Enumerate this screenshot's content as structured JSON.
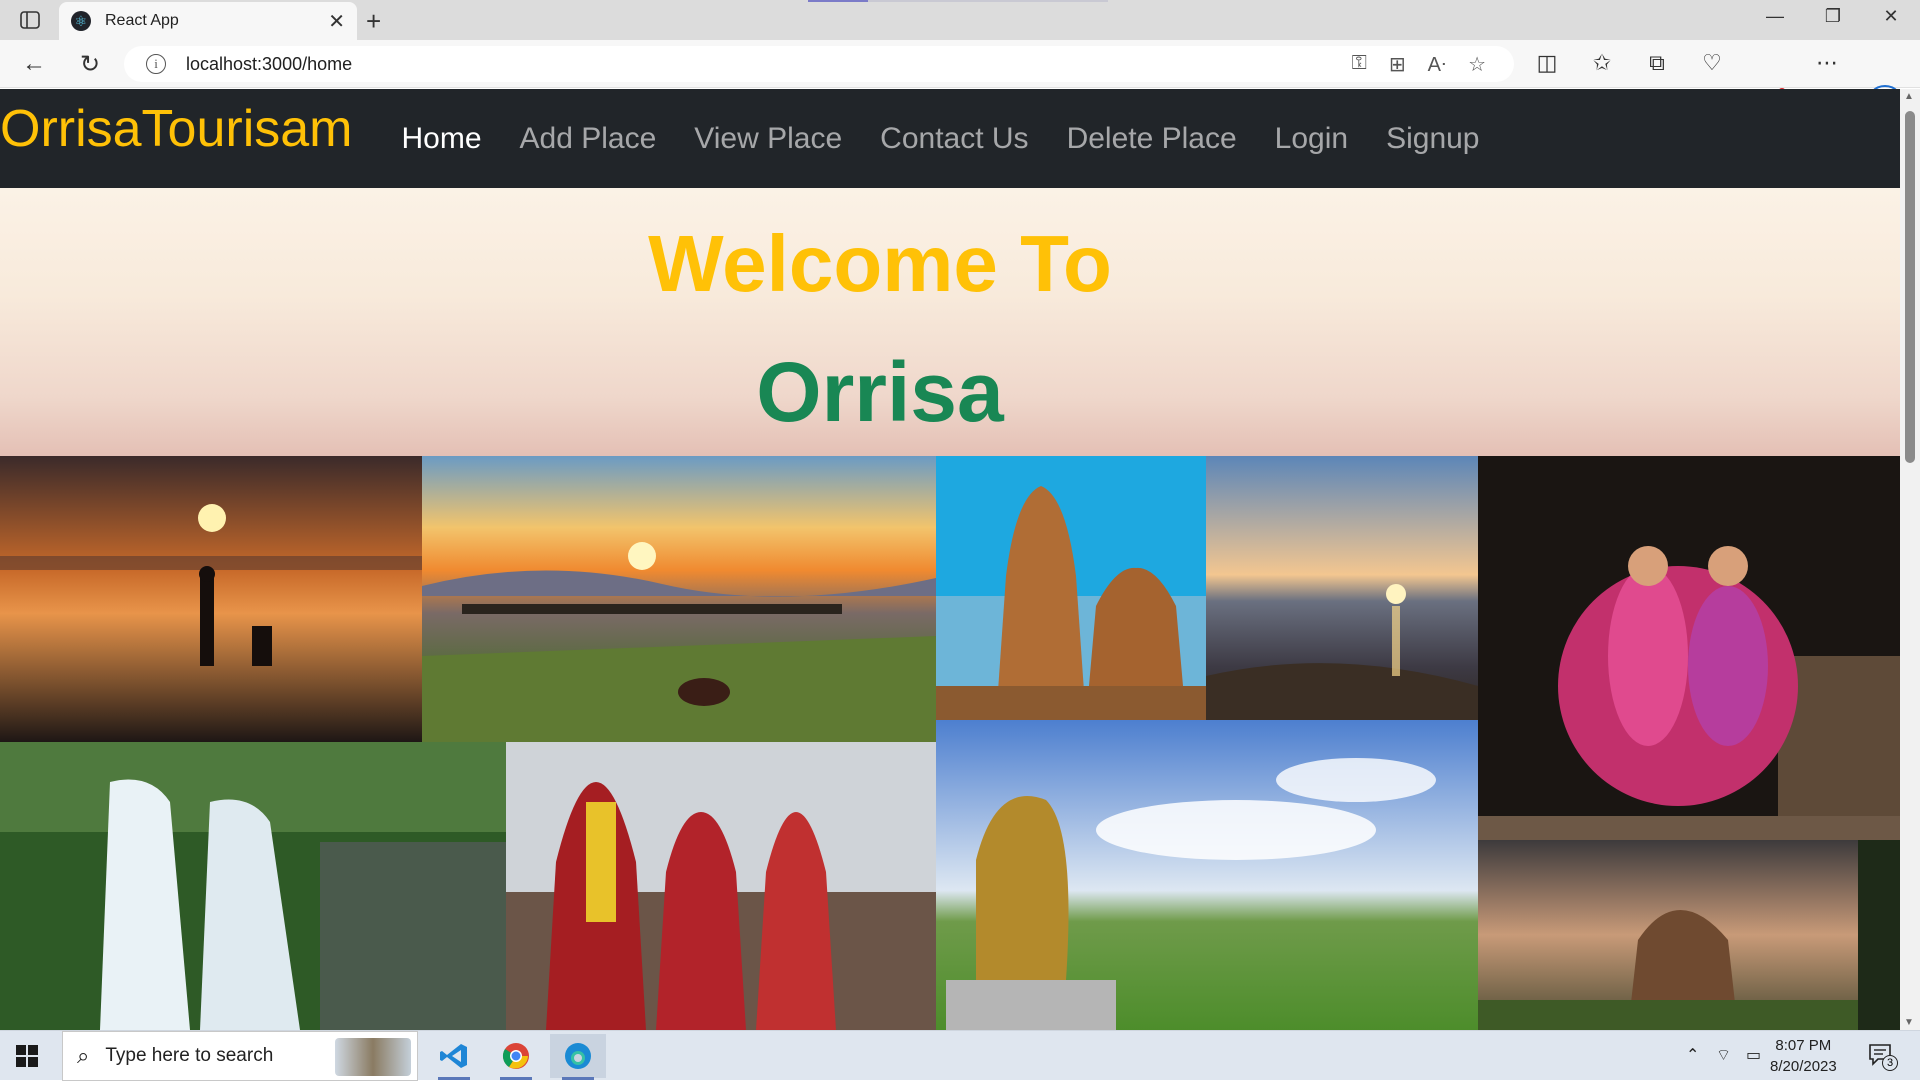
{
  "browser": {
    "tab_title": "React App",
    "url": "localhost:3000/home"
  },
  "icons": {
    "tab_actions": "tab-actions-icon",
    "favicon": "react-logo-icon",
    "tab_close": "close-icon",
    "new_tab": "plus-icon",
    "back": "back-arrow-icon",
    "refresh": "refresh-icon",
    "site_info": "info-icon",
    "password_key": "key-icon",
    "apps": "apps-icon",
    "read_aloud": "read-aloud-icon",
    "favorite": "star-icon",
    "split_screen": "split-screen-icon",
    "favorites": "favorites-icon",
    "collections": "collections-icon",
    "performance": "heart-pulse-icon",
    "profile": "avatar-icon",
    "more": "more-icon",
    "copilot": "bing-icon",
    "start": "windows-start-icon",
    "search": "search-icon",
    "vscode": "vscode-icon",
    "chrome": "chrome-icon",
    "edge": "edge-icon",
    "notifications": "notification-icon"
  },
  "site": {
    "brand": "OrrisaTourisam",
    "nav": [
      {
        "label": "Home",
        "active": true
      },
      {
        "label": "Add Place",
        "active": false
      },
      {
        "label": "View Place",
        "active": false
      },
      {
        "label": "Contact Us",
        "active": false
      },
      {
        "label": "Delete Place",
        "active": false
      },
      {
        "label": "Login",
        "active": false
      },
      {
        "label": "Signup",
        "active": false
      }
    ],
    "hero": {
      "line1": "Welcome To",
      "line2": "Orrisa"
    },
    "colors": {
      "navbar_bg": "#212529",
      "brand": "#ffc107",
      "welcome": "#ffc107",
      "place": "#198754"
    }
  },
  "taskbar": {
    "search_placeholder": "Type here to search",
    "time": "8:07 PM",
    "date": "8/20/2023",
    "notification_count": "3"
  }
}
